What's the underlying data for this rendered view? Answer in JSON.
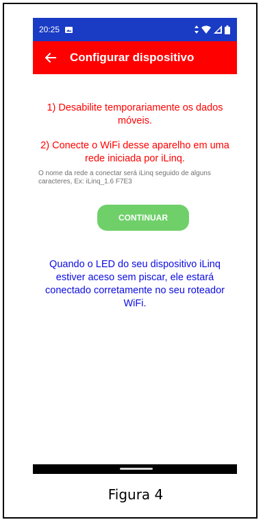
{
  "status_bar": {
    "time": "20:25",
    "icons": [
      "image-notification-icon",
      "data-arrows-icon",
      "wifi-icon",
      "signal-icon",
      "battery-icon"
    ],
    "color": "#1a3bc4"
  },
  "app_bar": {
    "title": "Configurar dispositivo",
    "back_icon": "back-arrow-icon",
    "color": "#ff0000"
  },
  "instructions": {
    "step1": "1) Desabilite temporariamente os dados móveis.",
    "step2": "2) Conecte o WiFi desse aparelho em uma rede iniciada por iLinq.",
    "note": "O nome da rede a conectar será iLinq seguido de alguns caracteres, Ex: iLinq_1.6 F7E3",
    "color": "#ff0000"
  },
  "continue_button": {
    "label": "CONTINUAR",
    "color": "#6fd06a"
  },
  "led_info": {
    "text": "Quando o LED do seu dispositivo iLinq estiver aceso sem piscar, ele estará conectado corretamente no seu roteador WiFi.",
    "color": "#0b0be0"
  },
  "caption": "Figura 4"
}
